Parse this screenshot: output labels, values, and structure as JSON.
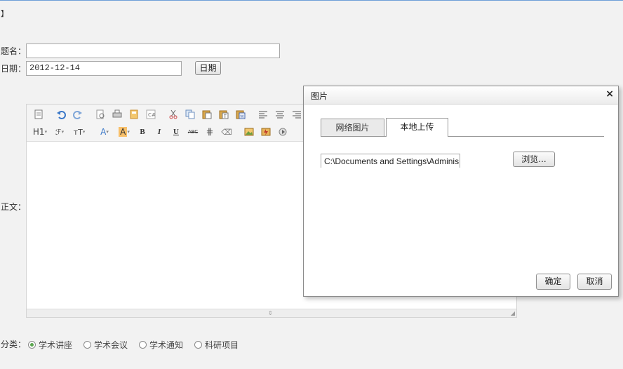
{
  "page": {
    "corner_mark": "】",
    "title_label": "题名：",
    "title_value": "",
    "date_label": "日期：",
    "date_value": "2012-12-14",
    "date_button": "日期",
    "body_label": "正文：",
    "category_label": "分类：",
    "categories": [
      {
        "label": "学术讲座",
        "checked": true
      },
      {
        "label": "学术会议",
        "checked": false
      },
      {
        "label": "学术通知",
        "checked": false
      },
      {
        "label": "科研项目",
        "checked": false
      }
    ]
  },
  "editor": {
    "toolbar_row1": [
      "source-icon",
      "undo-icon",
      "redo-icon",
      "preview-icon",
      "print-icon",
      "template-icon",
      "code-icon",
      "cut-icon",
      "copy-icon",
      "paste-icon",
      "paste-text-icon",
      "paste-word-icon",
      "align-left-icon",
      "align-center-icon",
      "align-right-icon",
      "align-justify-icon"
    ],
    "toolbar_row2": [
      {
        "icon": "heading-icon",
        "text": "H1"
      },
      {
        "icon": "font-family-icon",
        "text": "ℱ"
      },
      {
        "icon": "font-size-icon",
        "text": "тT"
      },
      {
        "icon": "font-color-icon",
        "text": "A"
      },
      {
        "icon": "highlight-icon",
        "text": "A"
      },
      {
        "icon": "bold-icon",
        "text": "B"
      },
      {
        "icon": "italic-icon",
        "text": "I"
      },
      {
        "icon": "underline-icon",
        "text": "U"
      },
      {
        "icon": "strikethrough-icon",
        "text": "ABC"
      },
      {
        "icon": "line-height-icon",
        "text": "⋕"
      },
      {
        "icon": "remove-format-icon",
        "text": "⌫"
      },
      {
        "icon": "image-icon",
        "text": ""
      },
      {
        "icon": "flash-icon",
        "text": ""
      },
      {
        "icon": "media-icon",
        "text": ""
      }
    ]
  },
  "dialog": {
    "title": "图片",
    "close_glyph": "×",
    "tabs": [
      {
        "label": "网络图片",
        "active": false
      },
      {
        "label": "本地上传",
        "active": true
      }
    ],
    "file_path": "C:\\Documents and Settings\\Adminis",
    "browse_button": "浏览...",
    "ok_button": "确定",
    "cancel_button": "取消"
  },
  "colors": {
    "background": "#f2f2f2",
    "radio_checked": "#5aa54e",
    "undo_blue": "#3b78c8",
    "highlight_bg": "#f8c06a"
  }
}
